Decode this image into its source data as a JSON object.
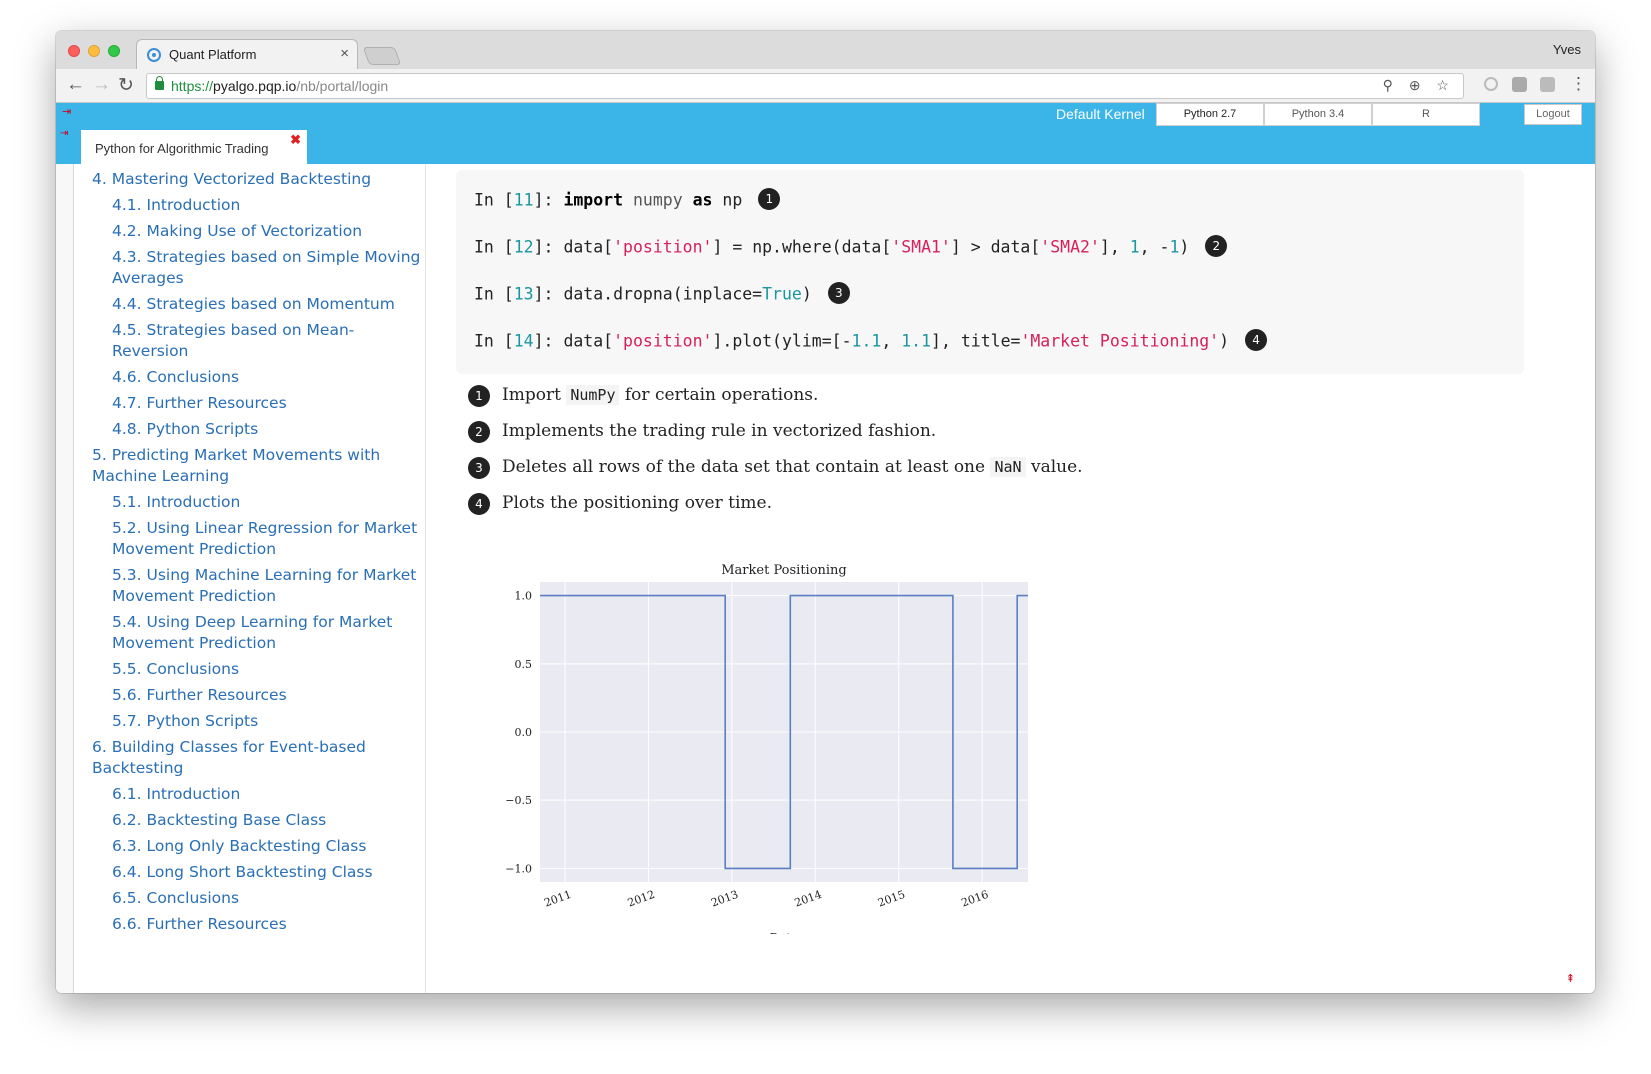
{
  "browser": {
    "tab_title": "Quant Platform",
    "user": "Yves",
    "url_scheme": "https://",
    "url_host": "pyalgo.pqp.io",
    "url_path": "/nb/portal/login"
  },
  "appbar": {
    "kernel_label": "Default Kernel",
    "kernels": [
      "Python 2.7",
      "Python 3.4",
      "R",
      ""
    ],
    "logout": "Logout"
  },
  "notebook_tab": "Python for Algorithmic Trading",
  "toc": [
    {
      "label": "4. Mastering Vectorized Backtesting",
      "level": 1
    },
    {
      "label": "4.1. Introduction",
      "level": 2
    },
    {
      "label": "4.2. Making Use of Vectorization",
      "level": 2
    },
    {
      "label": "4.3. Strategies based on Simple Moving Averages",
      "level": 2
    },
    {
      "label": "4.4. Strategies based on Momentum",
      "level": 2
    },
    {
      "label": "4.5. Strategies based on Mean-Reversion",
      "level": 2
    },
    {
      "label": "4.6. Conclusions",
      "level": 2
    },
    {
      "label": "4.7. Further Resources",
      "level": 2
    },
    {
      "label": "4.8. Python Scripts",
      "level": 2
    },
    {
      "label": "5. Predicting Market Movements with Machine Learning",
      "level": 1
    },
    {
      "label": "5.1. Introduction",
      "level": 2
    },
    {
      "label": "5.2. Using Linear Regression for Market Movement Prediction",
      "level": 2
    },
    {
      "label": "5.3. Using Machine Learning for Market Movement Prediction",
      "level": 2
    },
    {
      "label": "5.4. Using Deep Learning for Market Movement Prediction",
      "level": 2
    },
    {
      "label": "5.5. Conclusions",
      "level": 2
    },
    {
      "label": "5.6. Further Resources",
      "level": 2
    },
    {
      "label": "5.7. Python Scripts",
      "level": 2
    },
    {
      "label": "6. Building Classes for Event-based Backtesting",
      "level": 1
    },
    {
      "label": "6.1. Introduction",
      "level": 2
    },
    {
      "label": "6.2. Backtesting Base Class",
      "level": 2
    },
    {
      "label": "6.3. Long Only Backtesting Class",
      "level": 2
    },
    {
      "label": "6.4. Long Short Backtesting Class",
      "level": 2
    },
    {
      "label": "6.5. Conclusions",
      "level": 2
    },
    {
      "label": "6.6. Further Resources",
      "level": 2
    }
  ],
  "code_cells": [
    {
      "prompt": "In [",
      "num": "11",
      "close": "]: ",
      "callout": "1"
    },
    {
      "prompt": "In [",
      "num": "12",
      "close": "]: ",
      "callout": "2"
    },
    {
      "prompt": "In [",
      "num": "13",
      "close": "]: ",
      "callout": "3"
    },
    {
      "prompt": "In [",
      "num": "14",
      "close": "]: ",
      "callout": "4"
    }
  ],
  "code": {
    "c11_import": "import",
    "c11_mod": "numpy",
    "c11_as": "as",
    "c11_alias": "np",
    "c12_a": "data[",
    "c12_s1": "'position'",
    "c12_b": "] = np.where(data[",
    "c12_s2": "'SMA1'",
    "c12_c": "] > data[",
    "c12_s3": "'SMA2'",
    "c12_d": "], ",
    "c12_n1": "1",
    "c12_e": ", -",
    "c12_n2": "1",
    "c12_f": ")",
    "c13_a": "data.dropna(inplace=",
    "c13_t": "True",
    "c13_b": ")",
    "c14_a": "data[",
    "c14_s1": "'position'",
    "c14_b": "].plot(ylim=[-",
    "c14_n1": "1.1",
    "c14_c": ", ",
    "c14_n2": "1.1",
    "c14_d": "], title=",
    "c14_s2": "'Market Positioning'",
    "c14_e": ")"
  },
  "notes": [
    {
      "n": "1",
      "pre": "Import ",
      "code": "NumPy",
      "post": " for certain operations."
    },
    {
      "n": "2",
      "pre": "Implements the trading rule in vectorized fashion.",
      "code": "",
      "post": ""
    },
    {
      "n": "3",
      "pre": "Deletes all rows of the data set that contain at least one ",
      "code": "NaN",
      "post": " value."
    },
    {
      "n": "4",
      "pre": "Plots the positioning over time.",
      "code": "",
      "post": ""
    }
  ],
  "colors": {
    "accent": "#3bb5e8",
    "link": "#2a6fb5",
    "line": "#5b7fc4",
    "plot_bg": "#eaeaf2"
  },
  "chart_data": {
    "type": "line",
    "title": "Market Positioning",
    "xlabel": "Date",
    "ylabel": "",
    "x_ticks": [
      "2011",
      "2012",
      "2013",
      "2014",
      "2015",
      "2016"
    ],
    "y_ticks": [
      "1.0",
      "0.5",
      "0.0",
      "−0.5",
      "−1.0"
    ],
    "y_tick_values": [
      1.0,
      0.5,
      0.0,
      -0.5,
      -1.0
    ],
    "ylim": [
      -1.1,
      1.1
    ],
    "xlim": [
      2010.7,
      2016.55
    ],
    "grid": true,
    "series": [
      {
        "x": [
          2010.7,
          2012.92,
          2012.92,
          2013.7,
          2013.7,
          2015.65,
          2015.65,
          2016.42,
          2016.42,
          2016.55
        ],
        "y": [
          1,
          1,
          -1,
          -1,
          1,
          1,
          -1,
          -1,
          1,
          1
        ]
      }
    ]
  },
  "icons": {
    "back": "←",
    "forward": "→",
    "reload": "↻",
    "url_icons": "⚲ ⊕ ☆",
    "menu": "⋮",
    "pin": "⇥",
    "close_tab": "×",
    "close_nb": "✖",
    "scroll_top": "⇞"
  }
}
